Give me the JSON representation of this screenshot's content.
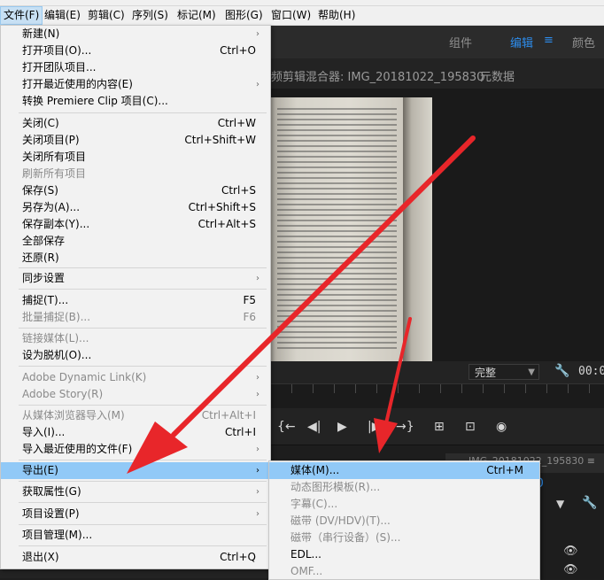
{
  "menubar": [
    {
      "label": "文件(F)",
      "active": true
    },
    {
      "label": "编辑(E)"
    },
    {
      "label": "剪辑(C)"
    },
    {
      "label": "序列(S)"
    },
    {
      "label": "标记(M)"
    },
    {
      "label": "图形(G)"
    },
    {
      "label": "窗口(W)"
    },
    {
      "label": "帮助(H)"
    }
  ],
  "workspaces": {
    "assembly": "组件",
    "editing": "编辑",
    "editing_icon": "≡",
    "color": "颜色"
  },
  "source_panel": {
    "title": "频剪辑混合器: IMG_20181022_195830",
    "metadata_tab": "元数据"
  },
  "monitor": {
    "fit_value": "完整",
    "timecode": "00:0"
  },
  "sequence_tab": {
    "label": "IMG_20181022_195830",
    "menu_icon": "≡"
  },
  "lower_panel": {
    "tab_label": "效果",
    "blue_text": "0"
  },
  "file_menu": {
    "items": [
      {
        "label": "新建(N)",
        "submenu": true
      },
      {
        "label": "打开项目(O)...",
        "shortcut": "Ctrl+O"
      },
      {
        "label": "打开团队项目..."
      },
      {
        "label": "打开最近使用的内容(E)",
        "submenu": true
      },
      {
        "label": "转换 Premiere Clip 项目(C)..."
      },
      {
        "label": "关闭(C)",
        "shortcut": "Ctrl+W"
      },
      {
        "label": "关闭项目(P)",
        "shortcut": "Ctrl+Shift+W"
      },
      {
        "label": "关闭所有项目"
      },
      {
        "label": "刷新所有项目",
        "disabled": true
      },
      {
        "label": "保存(S)",
        "shortcut": "Ctrl+S"
      },
      {
        "label": "另存为(A)...",
        "shortcut": "Ctrl+Shift+S"
      },
      {
        "label": "保存副本(Y)...",
        "shortcut": "Ctrl+Alt+S"
      },
      {
        "label": "全部保存"
      },
      {
        "label": "还原(R)"
      },
      {
        "label": "同步设置",
        "submenu": true
      },
      {
        "label": "捕捉(T)...",
        "shortcut": "F5"
      },
      {
        "label": "批量捕捉(B)...",
        "shortcut": "F6",
        "disabled": true
      },
      {
        "label": "链接媒体(L)...",
        "disabled": true
      },
      {
        "label": "设为脱机(O)..."
      },
      {
        "label": "Adobe Dynamic Link(K)",
        "submenu": true,
        "disabled": true
      },
      {
        "label": "Adobe Story(R)",
        "submenu": true,
        "disabled": true
      },
      {
        "label": "从媒体浏览器导入(M)",
        "shortcut": "Ctrl+Alt+I",
        "disabled": true
      },
      {
        "label": "导入(I)...",
        "shortcut": "Ctrl+I"
      },
      {
        "label": "导入最近使用的文件(F)",
        "submenu": true
      },
      {
        "label": "导出(E)",
        "submenu": true,
        "highlighted": true
      },
      {
        "label": "获取属性(G)",
        "submenu": true
      },
      {
        "label": "项目设置(P)",
        "submenu": true
      },
      {
        "label": "项目管理(M)..."
      },
      {
        "label": "退出(X)",
        "shortcut": "Ctrl+Q"
      }
    ]
  },
  "export_submenu": {
    "items": [
      {
        "label": "媒体(M)...",
        "shortcut": "Ctrl+M",
        "highlighted": true
      },
      {
        "label": "动态图形模板(R)...",
        "disabled": true
      },
      {
        "label": "字幕(C)...",
        "disabled": true
      },
      {
        "label": "磁带 (DV/HDV)(T)...",
        "disabled": true
      },
      {
        "label": "磁带（串行设备）(S)...",
        "disabled": true
      },
      {
        "label": "EDL..."
      },
      {
        "label": "OMF...",
        "disabled": true
      }
    ]
  },
  "colors": {
    "arrow": "#e8262a",
    "highlight": "#91c9f7",
    "accent": "#2d8ceb"
  }
}
